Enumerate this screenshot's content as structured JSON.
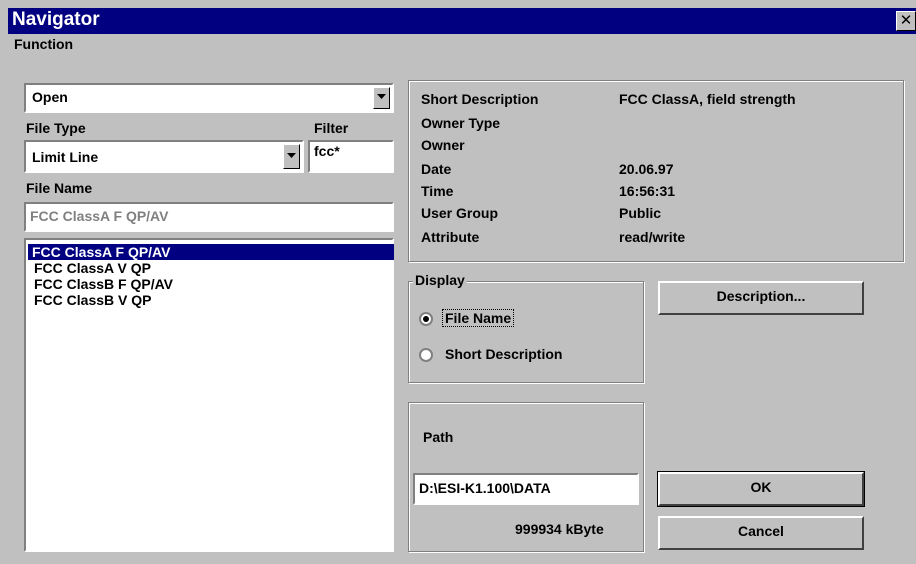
{
  "window": {
    "title": "Navigator",
    "close_symbol": "✕"
  },
  "function": {
    "label": "Function",
    "value": "Open"
  },
  "file_type": {
    "label": "File Type",
    "value": "Limit Line"
  },
  "filter": {
    "label": "Filter",
    "value": "fcc*"
  },
  "file_name": {
    "label": "File Name",
    "value": "FCC ClassA F QP/AV",
    "items": [
      "FCC ClassA F QP/AV",
      "FCC ClassA V QP",
      "FCC ClassB F QP/AV",
      "FCC ClassB V QP"
    ],
    "selected_index": 0
  },
  "info": [
    {
      "key": "Short Description",
      "value": "FCC ClassA, field strength"
    },
    {
      "key": "Owner Type",
      "value": ""
    },
    {
      "key": "Owner",
      "value": ""
    },
    {
      "key": "Date",
      "value": "20.06.97"
    },
    {
      "key": "Time",
      "value": "16:56:31"
    },
    {
      "key": "User Group",
      "value": "Public"
    },
    {
      "key": "Attribute",
      "value": "read/write"
    }
  ],
  "display": {
    "label": "Display",
    "options": [
      "File Name",
      "Short Description"
    ],
    "selected_index": 0
  },
  "path": {
    "label": "Path",
    "value": "D:\\ESI-K1.100\\DATA",
    "free_space": "999934 kByte"
  },
  "buttons": {
    "description": "Description...",
    "ok": "OK",
    "cancel": "Cancel"
  },
  "colors": {
    "titlebar": "#000080",
    "face": "#c0c0c0",
    "selection": "#000080"
  }
}
